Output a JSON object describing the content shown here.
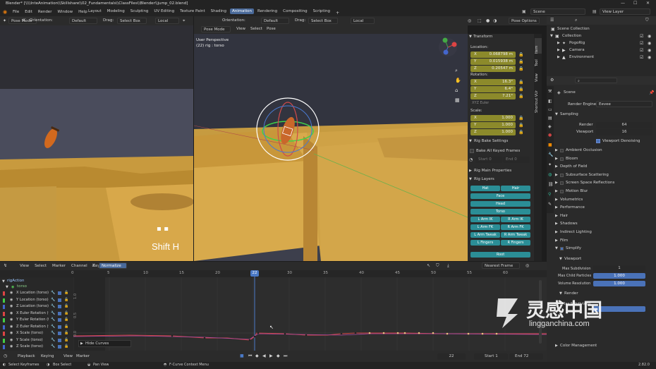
{
  "title_bar": {
    "title": "Blender* [\\\\\\\\InteAnimation\\\\Skillshare\\\\02_Fundamentals\\\\ClassFiles\\\\Blender\\\\jump_02.blend]"
  },
  "top_menu": [
    "File",
    "Edit",
    "Render",
    "Window",
    "Help"
  ],
  "workspaces": [
    "Layout",
    "Modeling",
    "Sculpting",
    "UV Editing",
    "Texture Paint",
    "Shading",
    "Animation",
    "Rendering",
    "Compositing",
    "Scripting"
  ],
  "active_workspace": "Animation",
  "scene_name": "Scene",
  "view_layer": "View Layer",
  "left_viewport": {
    "mode": "Pose Mode",
    "orientation_label": "Orientation:",
    "orientation": "Default",
    "drag_label": "Drag:",
    "select_box": "Select Box",
    "pivot": "Local",
    "overlay_text": "Shift H"
  },
  "main_viewport": {
    "mode": "Pose Mode",
    "menus": [
      "View",
      "Select",
      "Pose"
    ],
    "orientation_label": "Orientation:",
    "orientation": "Default",
    "drag_label": "Drag:",
    "select_box": "Select Box",
    "pivot": "Local",
    "pose_options": "Pose Options",
    "perspective": "User Perspective",
    "object_info": "(22) rig : torso"
  },
  "npanel": {
    "transform_header": "Transform",
    "location_label": "Location:",
    "location": [
      {
        "axis": "X",
        "value": "0.068798 m"
      },
      {
        "axis": "Y",
        "value": "0.015938 m"
      },
      {
        "axis": "Z",
        "value": "0.20547 m"
      }
    ],
    "rotation_label": "Rotation:",
    "rotation": [
      {
        "axis": "X",
        "value": "16.3°"
      },
      {
        "axis": "Y",
        "value": "6.4°"
      },
      {
        "axis": "Z",
        "value": "7.21°"
      }
    ],
    "rotation_mode": "XYZ Euler",
    "scale_label": "Scale:",
    "scale": [
      {
        "axis": "X",
        "value": "1.000"
      },
      {
        "axis": "Y",
        "value": "1.000"
      },
      {
        "axis": "Z",
        "value": "1.000"
      }
    ],
    "rig_bake_header": "Rig Bake Settings",
    "bake_all": "Bake All Keyed Frames",
    "start_label": "Start",
    "start_value": "0",
    "end_label": "End",
    "end_value": "0",
    "rig_main_header": "Rig Main Properties",
    "rig_layers_header": "Rig Layers",
    "layer_buttons": [
      "Hat",
      "Hair",
      "Face",
      "Head",
      "Torso",
      "L Arm IK",
      "R Arm IK",
      "L Arm FK",
      "R Arm FK",
      "L Arm Tweak",
      "R Arm Tweak",
      "L Fingers",
      "R Fingers",
      "Root"
    ],
    "tabs": [
      "Item",
      "Tool",
      "View",
      "Shortcut VUr"
    ]
  },
  "outliner": {
    "root": "Scene Collection",
    "items": [
      "Collection",
      "PogoRig",
      "Camera",
      "Environment"
    ]
  },
  "properties": {
    "search_placeholder": "",
    "scene_label": "Scene",
    "render_engine_label": "Render Engine",
    "render_engine": "Eevee",
    "sampling": "Sampling",
    "render_label": "Render",
    "render_value": "64",
    "viewport_label": "Viewport",
    "viewport_value": "16",
    "viewport_denoising": "Viewport Denoising",
    "sections": [
      "Ambient Occlusion",
      "Bloom",
      "Depth of Field",
      "Subsurface Scattering",
      "Screen Space Reflections",
      "Motion Blur",
      "Volumetrics",
      "Performance",
      "Hair",
      "Shadows",
      "Indirect Lighting",
      "Film",
      "Simplify"
    ],
    "simplify_viewport": "Viewport",
    "max_subdivision_label": "Max Subdivision",
    "max_subdivision": "1",
    "max_child_label": "Max Child Particles",
    "max_child": "1.000",
    "volume_res_label": "Volume Resolution",
    "volume_res": "1.000",
    "simplify_render": "Render",
    "max_subdiv_render_label": "Max Subdivision",
    "color_management": "Color Management"
  },
  "graph_editor": {
    "menus": [
      "View",
      "Select",
      "Marker",
      "Channel",
      "Key"
    ],
    "normalize": "Normalize",
    "pivot": "Nearest Frame",
    "frame_ticks": [
      "0",
      "5",
      "10",
      "15",
      "20",
      "22",
      "25",
      "30",
      "35",
      "40",
      "45",
      "50",
      "55",
      "60"
    ],
    "current_frame": "22",
    "action": "rigAction",
    "group": "torso",
    "channels": [
      "X Location (torso)",
      "Y Location (torso)",
      "Z Location (torso)",
      "X Euler Rotation (to...",
      "Y Euler Rotation (to...",
      "Z Euler Rotation (to...",
      "X Scale (torso)",
      "Y Scale (torso)",
      "Z Scale (torso)"
    ],
    "hide_curves": "Hide Curves",
    "value_ticks": [
      "1.0",
      "0.5",
      "0.0"
    ]
  },
  "timeline_footer": {
    "playback": "Playback",
    "keying": "Keying",
    "view": "View",
    "marker": "Marker",
    "current_frame": "22",
    "start_label": "Start",
    "start": "1",
    "end_label": "End",
    "end": "72"
  },
  "status_bar": {
    "select_keyframes": "Select Keyframes",
    "box_select": "Box Select",
    "pan_view": "Pan View",
    "context_menu": "F-Curve Context Menu",
    "version": "2.82.0"
  },
  "watermark": {
    "logo_text": "灵感中国",
    "url": "lingganchina.com"
  }
}
